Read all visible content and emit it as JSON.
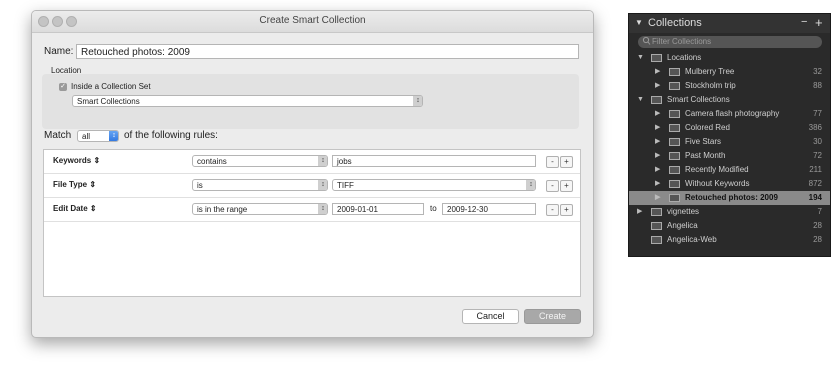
{
  "dialog": {
    "title": "Create Smart Collection",
    "name_label": "Name:",
    "name_value": "Retouched photos: 2009",
    "location_label": "Location",
    "inside_set_label": "Inside a Collection Set",
    "set_value": "Smart Collections",
    "match_label": "Match",
    "match_value": "all",
    "match_suffix": "of the following rules:",
    "rules": [
      {
        "field": "Keywords",
        "op": "contains",
        "value": "jobs"
      },
      {
        "field": "File Type",
        "op": "is",
        "value": "TIFF"
      },
      {
        "field": "Edit Date",
        "op": "is in the range",
        "value": "2009-01-01",
        "to_label": "to",
        "value2": "2009-12-30"
      }
    ],
    "minus": "-",
    "plus": "+",
    "cancel": "Cancel",
    "create": "Create"
  },
  "panel": {
    "title": "Collections",
    "header_minus": "−",
    "header_plus": "+",
    "filter_placeholder": "Filter Collections",
    "items": [
      {
        "name": "Locations",
        "count": ""
      },
      {
        "name": "Mulberry Tree",
        "count": "32"
      },
      {
        "name": "Stockholm trip",
        "count": "88"
      },
      {
        "name": "Smart Collections",
        "count": ""
      },
      {
        "name": "Camera flash photography",
        "count": "77"
      },
      {
        "name": "Colored Red",
        "count": "386"
      },
      {
        "name": "Five Stars",
        "count": "30"
      },
      {
        "name": "Past Month",
        "count": "72"
      },
      {
        "name": "Recently Modified",
        "count": "211"
      },
      {
        "name": "Without Keywords",
        "count": "872"
      },
      {
        "name": "Retouched photos: 2009",
        "count": "194"
      },
      {
        "name": "vignettes",
        "count": "7"
      },
      {
        "name": "Angelica",
        "count": "28"
      },
      {
        "name": "Angelica-Web",
        "count": "28"
      }
    ]
  },
  "icons": {
    "popup_arrows": "↕",
    "expanded": "▼",
    "collapsed": "▶",
    "search": "search-icon"
  }
}
